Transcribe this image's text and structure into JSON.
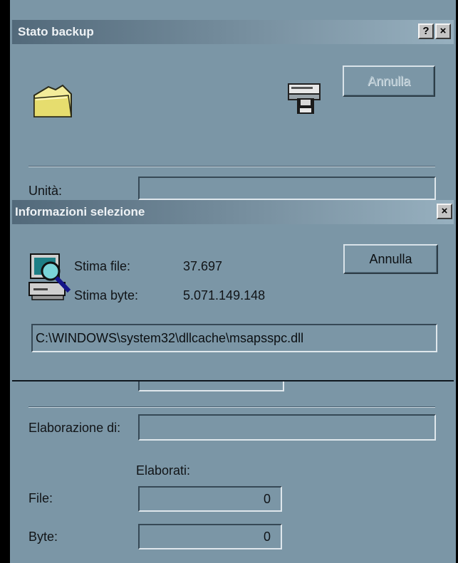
{
  "backup_dialog": {
    "title": "Stato backup",
    "help_button": "?",
    "close_button": "×",
    "cancel_label": "Annulla",
    "drive_label": "Unità:",
    "processing_label": "Elaborazione di:",
    "processed_header": "Elaborati:",
    "files_label": "File:",
    "files_value": "0",
    "bytes_label": "Byte:",
    "bytes_value": "0",
    "icons": [
      "folder-icon",
      "backup-drive-icon"
    ]
  },
  "selection_dialog": {
    "title": "Informazioni selezione",
    "close_button": "×",
    "cancel_label": "Annulla",
    "est_files_label": "Stima file:",
    "est_files_value": "37.697",
    "est_bytes_label": "Stima byte:",
    "est_bytes_value": "5.071.149.148",
    "current_path": "C:\\WINDOWS\\system32\\dllcache\\msapsspc.dll",
    "icons": [
      "computer-magnifier-icon"
    ]
  }
}
